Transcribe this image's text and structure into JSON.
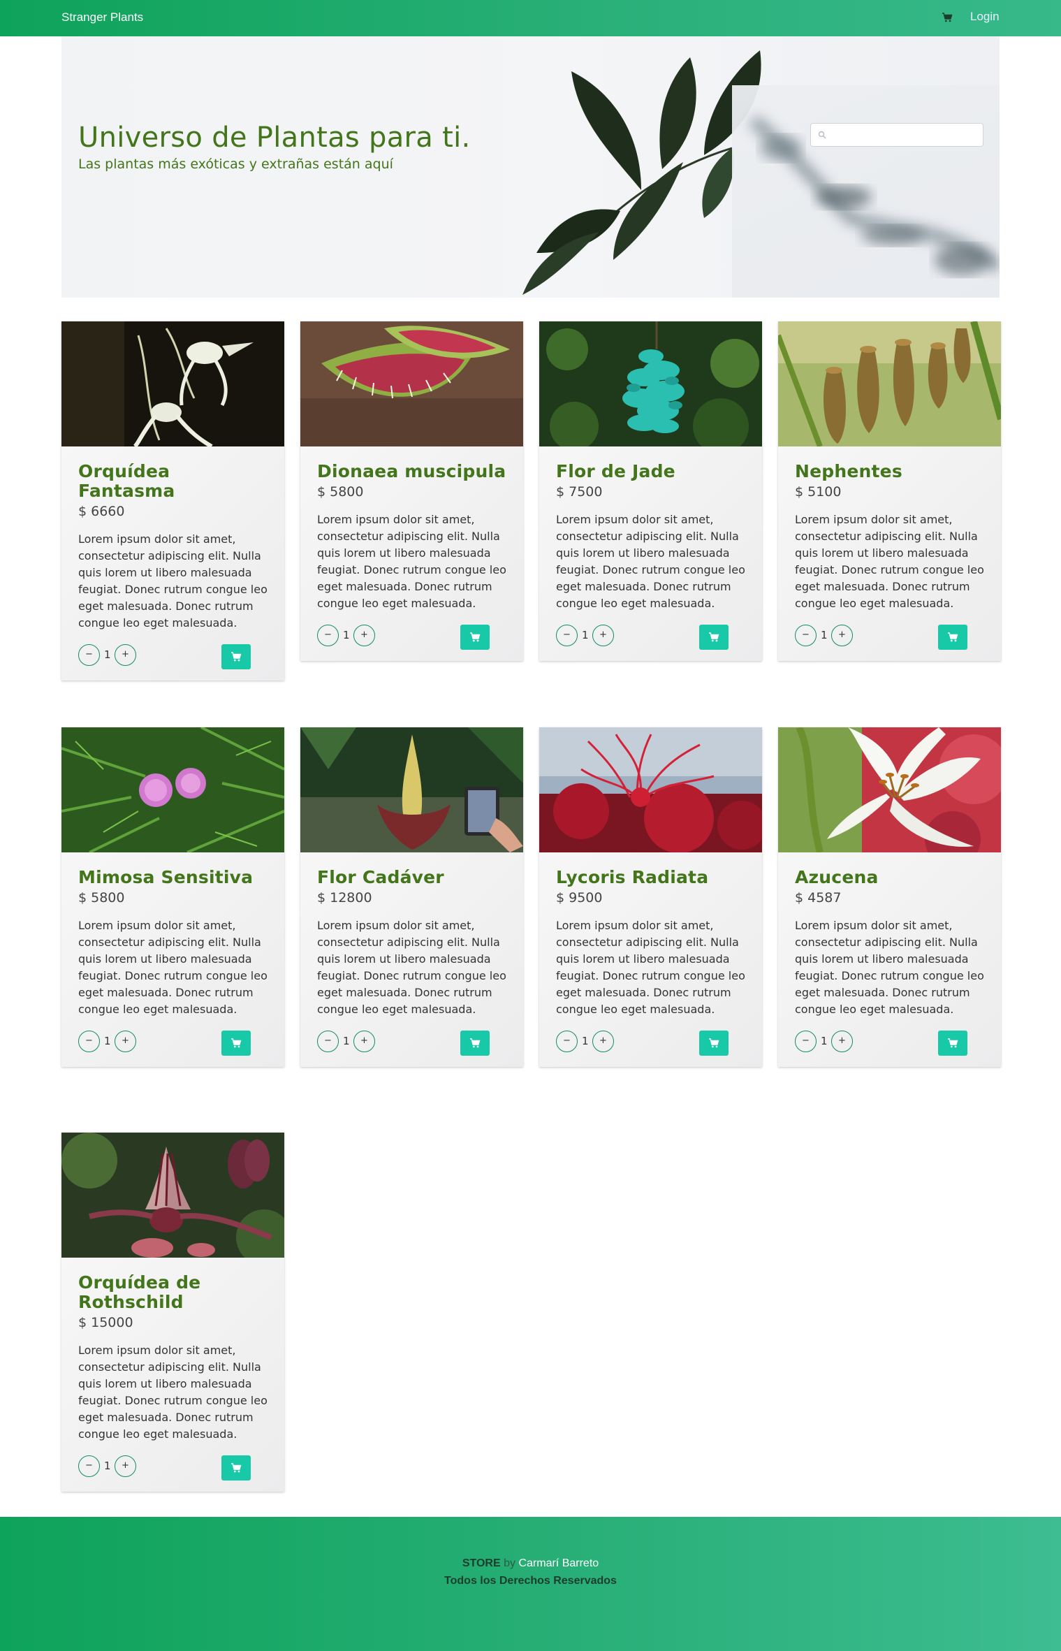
{
  "navbar": {
    "brand": "Stranger Plants",
    "cart_icon": "cart-icon",
    "login_label": "Login"
  },
  "hero": {
    "title": "Universo de Plantas para ti.",
    "subtitle": "Las plantas más exóticas y extrañas están aquí",
    "search": {
      "placeholder": "",
      "value": "",
      "icon": "search-icon"
    }
  },
  "products": [
    {
      "name": "Orquídea Fantasma",
      "price": "$ 6660",
      "description": "Lorem ipsum dolor sit amet, consectetur adipiscing elit. Nulla quis lorem ut libero malesuada feugiat. Donec rutrum congue leo eget malesuada. Donec rutrum congue leo eget malesuada.",
      "qty": "1",
      "minus": "−",
      "plus": "+",
      "image": "ghost-orchid"
    },
    {
      "name": "Dionaea muscipula",
      "price": "$ 5800",
      "description": "Lorem ipsum dolor sit amet, consectetur adipiscing elit. Nulla quis lorem ut libero malesuada feugiat. Donec rutrum congue leo eget malesuada. Donec rutrum congue leo eget malesuada.",
      "qty": "1",
      "minus": "−",
      "plus": "+",
      "image": "venus-flytrap"
    },
    {
      "name": "Flor de Jade",
      "price": "$ 7500",
      "description": "Lorem ipsum dolor sit amet, consectetur adipiscing elit. Nulla quis lorem ut libero malesuada feugiat. Donec rutrum congue leo eget malesuada. Donec rutrum congue leo eget malesuada.",
      "qty": "1",
      "minus": "−",
      "plus": "+",
      "image": "jade-vine"
    },
    {
      "name": "Nephentes",
      "price": "$ 5100",
      "description": "Lorem ipsum dolor sit amet, consectetur adipiscing elit. Nulla quis lorem ut libero malesuada feugiat. Donec rutrum congue leo eget malesuada. Donec rutrum congue leo eget malesuada.",
      "qty": "1",
      "minus": "−",
      "plus": "+",
      "image": "pitcher-plant"
    },
    {
      "name": "Mimosa Sensitiva",
      "price": "$ 5800",
      "description": "Lorem ipsum dolor sit amet, consectetur adipiscing elit. Nulla quis lorem ut libero malesuada feugiat. Donec rutrum congue leo eget malesuada. Donec rutrum congue leo eget malesuada.",
      "qty": "1",
      "minus": "−",
      "plus": "+",
      "image": "mimosa"
    },
    {
      "name": "Flor Cadáver",
      "price": "$ 12800",
      "description": "Lorem ipsum dolor sit amet, consectetur adipiscing elit. Nulla quis lorem ut libero malesuada feugiat. Donec rutrum congue leo eget malesuada. Donec rutrum congue leo eget malesuada.",
      "qty": "1",
      "minus": "−",
      "plus": "+",
      "image": "corpse-flower"
    },
    {
      "name": "Lycoris Radiata",
      "price": "$ 9500",
      "description": "Lorem ipsum dolor sit amet, consectetur adipiscing elit. Nulla quis lorem ut libero malesuada feugiat. Donec rutrum congue leo eget malesuada. Donec rutrum congue leo eget malesuada.",
      "qty": "1",
      "minus": "−",
      "plus": "+",
      "image": "red-spider-lily"
    },
    {
      "name": "Azucena",
      "price": "$ 4587",
      "description": "Lorem ipsum dolor sit amet, consectetur adipiscing elit. Nulla quis lorem ut libero malesuada feugiat. Donec rutrum congue leo eget malesuada. Donec rutrum congue leo eget malesuada.",
      "qty": "1",
      "minus": "−",
      "plus": "+",
      "image": "white-lily"
    },
    {
      "name": "Orquídea de Rothschild",
      "price": "$ 15000",
      "description": "Lorem ipsum dolor sit amet, consectetur adipiscing elit. Nulla quis lorem ut libero malesuada feugiat. Donec rutrum congue leo eget malesuada. Donec rutrum congue leo eget malesuada.",
      "qty": "1",
      "minus": "−",
      "plus": "+",
      "image": "rothschild-orchid"
    }
  ],
  "footer": {
    "store": "STORE",
    "by": "by",
    "author": "Carmarí Barreto",
    "rights": "Todos los Derechos Reservados"
  },
  "colors": {
    "accent": "#17c9a7",
    "brand_green": "#43751a",
    "nav_gradient_start": "#0ea35a",
    "nav_gradient_end": "#37b98a"
  }
}
